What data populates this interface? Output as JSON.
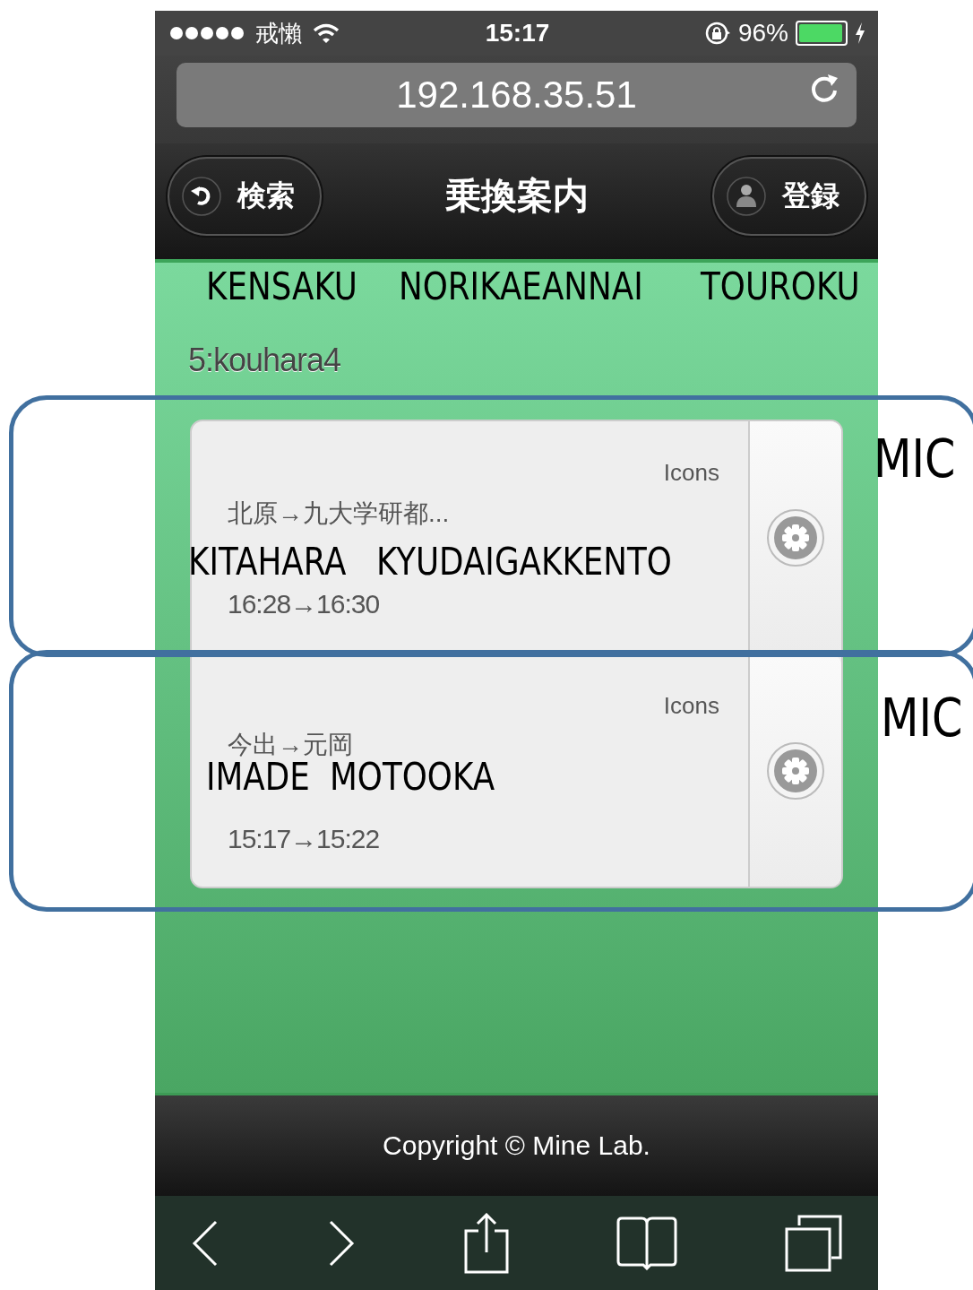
{
  "status_bar": {
    "carrier": "戒懶",
    "time": "15:17",
    "battery": "96%"
  },
  "address_bar": {
    "url": "192.168.35.51"
  },
  "nav_bar": {
    "back_button": "検索",
    "title": "乗換案内",
    "register_button": "登録"
  },
  "header_labels": [
    "KENSAKU",
    "NORIKAEANNAI",
    "TOUROKU"
  ],
  "user": "5:kouhara4",
  "routes": [
    {
      "badge": "Icons",
      "route": "北原→九大学研都...",
      "romaji": [
        "KITAHARA",
        "KYUDAIGAKKENTO"
      ],
      "time": "16:28→16:30",
      "annotation": "MIC"
    },
    {
      "badge": "Icons",
      "route": "今出→元岡",
      "romaji": [
        "IMADE",
        "MOTOOKA"
      ],
      "time": "15:17→15:22",
      "annotation": "MIC"
    }
  ],
  "footer": "Copyright © Mine Lab."
}
